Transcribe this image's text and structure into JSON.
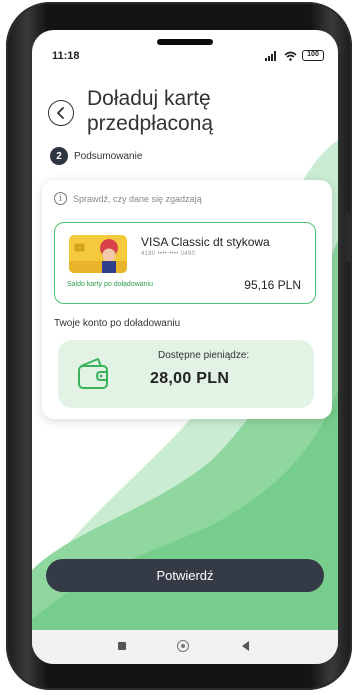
{
  "status_bar": {
    "time": "11:18",
    "signal_icon": "signal-icon",
    "wifi_icon": "wifi-icon",
    "battery_level": "100"
  },
  "header": {
    "back_icon": "chevron-left-icon",
    "title": "Doładuj kartę przedpłaconą"
  },
  "step": {
    "number": "2",
    "label": "Podsumowanie"
  },
  "summary": {
    "info_icon": "info-icon",
    "check_text": "Sprawdź, czy dane się zgadzają",
    "card": {
      "name": "VISA Classic dt stykowa",
      "number": "4180 •••• •••• 0490",
      "balance_label": "Saldo karty po doładowaniu",
      "balance_value": "95,16 PLN"
    },
    "account_label": "Twoje konto po doładowaniu",
    "funds": {
      "icon": "wallet-icon",
      "label": "Dostępne pieniądze:",
      "value": "28,00 PLN"
    }
  },
  "confirm_button": {
    "label": "Potwierdź"
  },
  "android_nav": {
    "recent_icon": "recent-apps-icon",
    "home_icon": "home-icon",
    "back_icon": "back-triangle-icon"
  },
  "colors": {
    "accent_green": "#4cc46f",
    "wave_green": "#8fd79f",
    "button_dark": "#353a47",
    "funds_bg": "#e2f3e6"
  }
}
